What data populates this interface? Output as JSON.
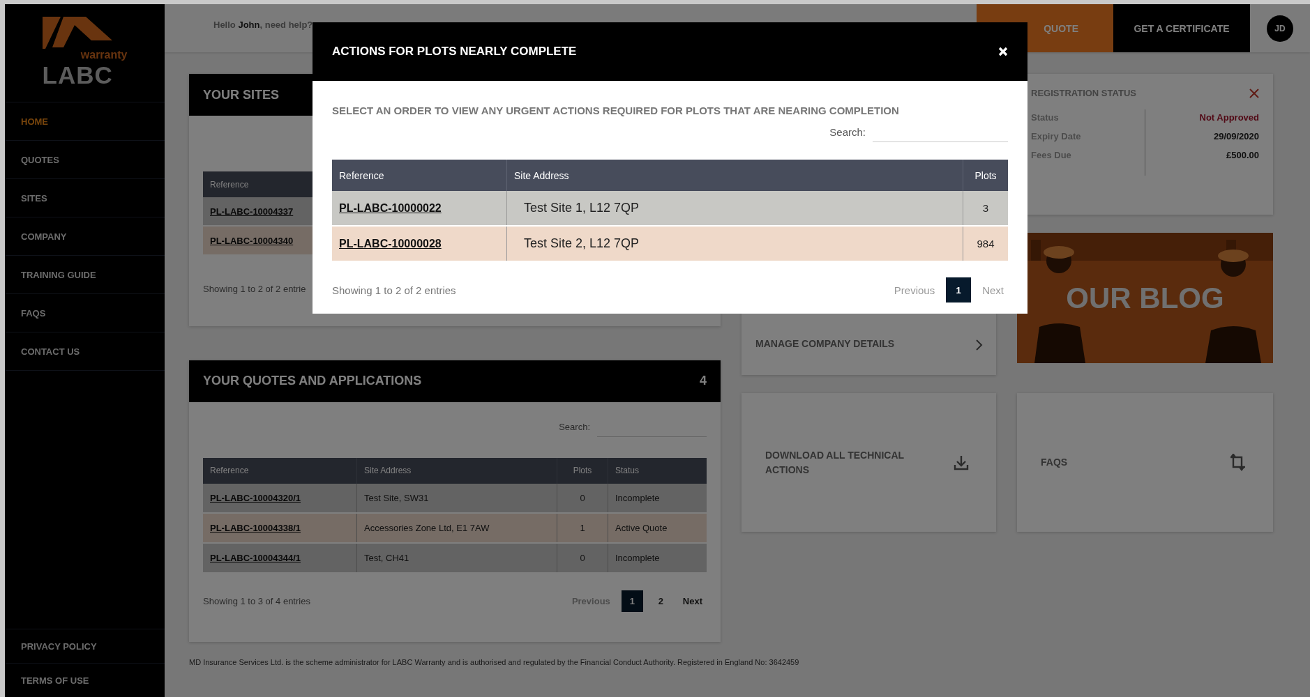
{
  "header": {
    "greeting": "Hello **John**, need help?",
    "buttons": [
      {
        "label": "QUOTE",
        "kind": "orange"
      },
      {
        "label": "GET A CERTIFICATE",
        "kind": "dark"
      }
    ],
    "avatar": "JD"
  },
  "sidebar": {
    "logo": {
      "tagline": "warranty",
      "name": "LABC"
    },
    "items": [
      {
        "label": "HOME",
        "selected": true
      },
      {
        "label": "QUOTES",
        "selected": false
      },
      {
        "label": "SITES",
        "selected": false
      },
      {
        "label": "COMPANY",
        "selected": false
      },
      {
        "label": "TRAINING GUIDE",
        "selected": false
      },
      {
        "label": "FAQS",
        "selected": false
      },
      {
        "label": "CONTACT US",
        "selected": false
      }
    ],
    "footer_items": [
      "PRIVACY POLICY",
      "TERMS OF USE"
    ]
  },
  "sites_card": {
    "title": "YOUR SITES",
    "columns": [
      "Reference"
    ],
    "rows": [
      [
        "PL-LABC-10004337"
      ],
      [
        "PL-LABC-10004340"
      ]
    ],
    "info": "Showing 1 to 2 of 2 entrie"
  },
  "quotes_card": {
    "title": "YOUR QUOTES AND APPLICATIONS",
    "count": "4",
    "search_label": "Search:",
    "columns": [
      "Reference",
      "Site Address",
      "Plots",
      "Status"
    ],
    "rows": [
      [
        "PL-LABC-10004320/1",
        "Test Site, SW31",
        "0",
        "Incomplete"
      ],
      [
        "PL-LABC-10004338/1",
        "Accessories Zone Ltd, E1 7AW",
        "1",
        "Active Quote"
      ],
      [
        "PL-LABC-10004344/1",
        "Test, CH41",
        "0",
        "Incomplete"
      ]
    ],
    "info": "Showing 1 to 3 of 4 entries",
    "pagination": {
      "previous": {
        "label": "Previous",
        "disabled": true
      },
      "pages": [
        {
          "label": "1",
          "selected": true
        },
        {
          "label": "2",
          "selected": false
        }
      ],
      "next": {
        "label": "Next",
        "disabled": false
      }
    }
  },
  "tiles": [
    {
      "label": "MANAGE COMPANY DETAILS",
      "kind": "chevron"
    },
    {
      "label": "DOWNLOAD ALL TECHNICAL ACTIONS",
      "kind": "download"
    },
    {
      "label": "FAQS",
      "kind": "crop"
    }
  ],
  "registration": {
    "title": "REGISTRATION STATUS",
    "rows": [
      {
        "label": "Status",
        "value": "Not Approved",
        "kind": "alert"
      },
      {
        "label": "Expiry Date",
        "value": "29/09/2020",
        "kind": "plain"
      },
      {
        "label": "Fees Due",
        "value": "£500.00",
        "kind": "plain"
      }
    ]
  },
  "blog": {
    "kind": "picture",
    "caption": "OUR BLOG"
  },
  "footer": "MD Insurance Services Ltd. is the scheme administrator for LABC Warranty and is authorised and regulated by the Financial Conduct Authority. Registered in England No: 3642459",
  "modal": {
    "title": "ACTIONS FOR PLOTS NEARLY COMPLETE",
    "subtitle": "SELECT AN ORDER TO VIEW ANY URGENT ACTIONS REQUIRED FOR PLOTS THAT ARE NEARING COMPLETION",
    "search_label": "Search:",
    "columns": [
      "Reference",
      "Site Address",
      "Plots"
    ],
    "rows": [
      [
        "PL-LABC-10000022",
        "Test Site 1, L12 7QP",
        "3"
      ],
      [
        "PL-LABC-10000028",
        "Test Site 2, L12 7QP",
        "984"
      ]
    ],
    "info": "Showing 1 to 2 of 2 entries",
    "pagination": {
      "previous": {
        "label": "Previous",
        "disabled": true
      },
      "pages": [
        {
          "label": "1",
          "selected": true
        }
      ],
      "next": {
        "label": "Next",
        "disabled": true
      }
    }
  }
}
